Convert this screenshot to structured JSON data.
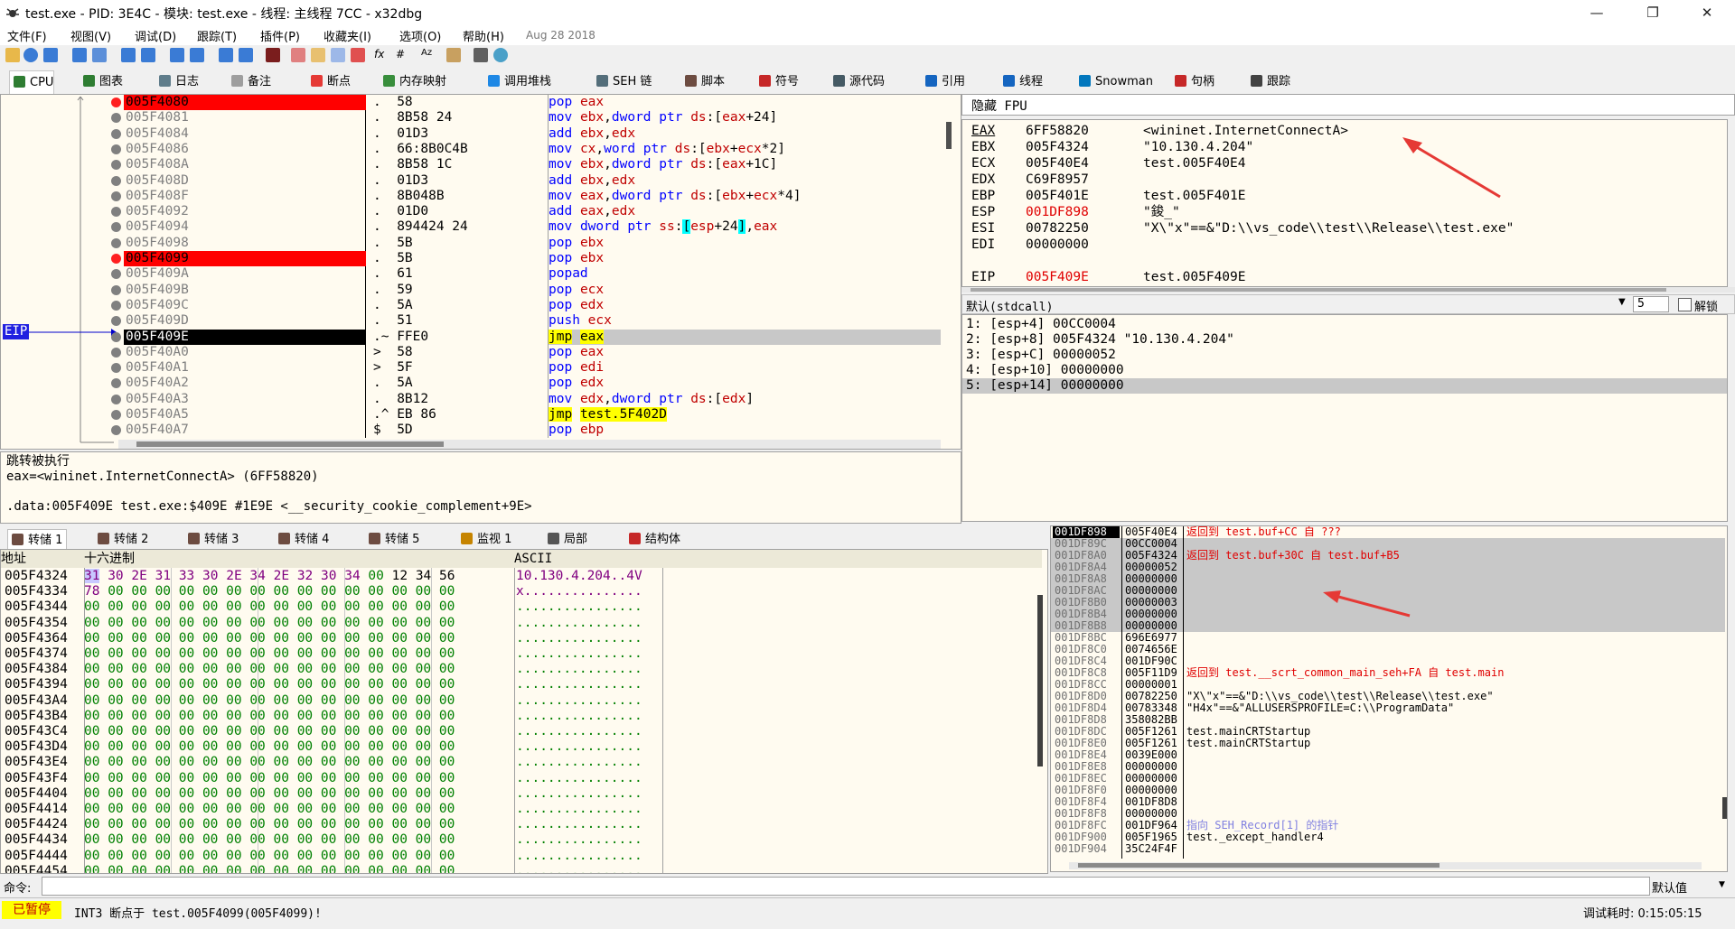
{
  "window": {
    "title": "test.exe - PID: 3E4C - 模块: test.exe - 线程: 主线程 7CC - x32dbg",
    "min_label": "—",
    "max_label": "❐",
    "close_label": "✕"
  },
  "menu": {
    "items": [
      "文件(F)",
      "视图(V)",
      "调试(D)",
      "跟踪(T)",
      "插件(P)",
      "收藏夹(I)",
      "选项(O)",
      "帮助(H)"
    ],
    "date": "Aug 28 2018"
  },
  "toolbar": {
    "fx": "fx",
    "hash": "#",
    "az": "Az"
  },
  "tabs": [
    {
      "label": "CPU",
      "icon": "cpu-icon",
      "color": "#2e7d32"
    },
    {
      "label": "图表",
      "icon": "graph-icon",
      "color": "#2e7d32"
    },
    {
      "label": "日志",
      "icon": "log-icon",
      "color": "#607d8b"
    },
    {
      "label": "备注",
      "icon": "notes-icon",
      "color": "#9e9e9e"
    },
    {
      "label": "断点",
      "icon": "breakpoint-icon",
      "color": "#e53935"
    },
    {
      "label": "内存映射",
      "icon": "memory-map-icon",
      "color": "#388e3c"
    },
    {
      "label": "调用堆栈",
      "icon": "call-stack-icon",
      "color": "#1e88e5"
    },
    {
      "label": "SEH 链",
      "icon": "seh-icon",
      "color": "#546e7a"
    },
    {
      "label": "脚本",
      "icon": "script-icon",
      "color": "#6d4c41"
    },
    {
      "label": "符号",
      "icon": "symbols-icon",
      "color": "#c62828"
    },
    {
      "label": "源代码",
      "icon": "source-icon",
      "color": "#455a64"
    },
    {
      "label": "引用",
      "icon": "references-icon",
      "color": "#1565c0"
    },
    {
      "label": "线程",
      "icon": "threads-icon",
      "color": "#1565c0"
    },
    {
      "label": "Snowman",
      "icon": "snowman-icon",
      "color": "#0277bd"
    },
    {
      "label": "句柄",
      "icon": "handles-icon",
      "color": "#c62828"
    },
    {
      "label": "跟踪",
      "icon": "trace-icon",
      "color": "#424242"
    }
  ],
  "disasm": {
    "eip_label": "EIP",
    "rows": [
      {
        "addr": "005F4080",
        "bp": true,
        "bytes": ".  58",
        "ins": "pop eax"
      },
      {
        "addr": "005F4081",
        "bytes": ".  8B58 24",
        "ins": "mov ebx,dword ptr ds:[eax+24]"
      },
      {
        "addr": "005F4084",
        "bytes": ".  01D3",
        "ins": "add ebx,edx"
      },
      {
        "addr": "005F4086",
        "bytes": ".  66:8B0C4B",
        "ins": "mov cx,word ptr ds:[ebx+ecx*2]"
      },
      {
        "addr": "005F408A",
        "bytes": ".  8B58 1C",
        "ins": "mov ebx,dword ptr ds:[eax+1C]"
      },
      {
        "addr": "005F408D",
        "bytes": ".  01D3",
        "ins": "add ebx,edx"
      },
      {
        "addr": "005F408F",
        "bytes": ".  8B048B",
        "ins": "mov eax,dword ptr ds:[ebx+ecx*4]"
      },
      {
        "addr": "005F4092",
        "bytes": ".  01D0",
        "ins": "add eax,edx"
      },
      {
        "addr": "005F4094",
        "bytes": ".  894424 24",
        "ins": "mov dword ptr ss:[esp+24],eax"
      },
      {
        "addr": "005F4098",
        "bytes": ".  5B",
        "ins": "pop ebx"
      },
      {
        "addr": "005F4099",
        "bp": true,
        "bytes": ".  5B",
        "ins": "pop ebx"
      },
      {
        "addr": "005F409A",
        "bytes": ".  61",
        "ins": "popad"
      },
      {
        "addr": "005F409B",
        "bytes": ".  59",
        "ins": "pop ecx"
      },
      {
        "addr": "005F409C",
        "bytes": ".  5A",
        "ins": "pop edx"
      },
      {
        "addr": "005F409D",
        "bytes": ".  51",
        "ins": "push ecx"
      },
      {
        "addr": "005F409E",
        "eip": true,
        "bytes": ".~ FFE0",
        "ins": "jmp eax"
      },
      {
        "addr": "005F40A0",
        "bytes": ">  58",
        "ins": "pop eax"
      },
      {
        "addr": "005F40A1",
        "bytes": ">  5F",
        "ins": "pop edi"
      },
      {
        "addr": "005F40A2",
        "bytes": ".  5A",
        "ins": "pop edx"
      },
      {
        "addr": "005F40A3",
        "bytes": ".  8B12",
        "ins": "mov edx,dword ptr ds:[edx]"
      },
      {
        "addr": "005F40A5",
        "bytes": ".^ EB 86",
        "ins": "jmp test.5F402D"
      },
      {
        "addr": "005F40A7",
        "bytes": "$  5D",
        "ins": "pop ebp"
      }
    ]
  },
  "info": {
    "line1": "跳转被执行",
    "line2": "eax=<wininet.InternetConnectA> (6FF58820)",
    "line3": ".data:005F409E test.exe:$409E #1E9E <__security_cookie_complement+9E>"
  },
  "regs": {
    "header": "隐藏 FPU",
    "rows": [
      {
        "name": "EAX",
        "value": "6FF58820",
        "comment": "<wininet.InternetConnectA>",
        "red": false,
        "ul": true
      },
      {
        "name": "EBX",
        "value": "005F4324",
        "comment": "\"10.130.4.204\""
      },
      {
        "name": "ECX",
        "value": "005F40E4",
        "comment": "test.005F40E4"
      },
      {
        "name": "EDX",
        "value": "C69F8957",
        "comment": ""
      },
      {
        "name": "EBP",
        "value": "005F401E",
        "comment": "test.005F401E"
      },
      {
        "name": "ESP",
        "value": "001DF898",
        "comment": "\"鋑_\"",
        "red": true
      },
      {
        "name": "ESI",
        "value": "00782250",
        "comment": "\"X\\\"x\"==&\"D:\\\\vs_code\\\\test\\\\Release\\\\test.exe\""
      },
      {
        "name": "EDI",
        "value": "00000000",
        "comment": ""
      },
      {
        "name": "EIP",
        "value": "005F409E",
        "comment": "test.005F409E",
        "red": true
      }
    ]
  },
  "callconv": {
    "label": "默认(stdcall)",
    "count": "5",
    "unlock": "解锁"
  },
  "args": [
    "1: [esp+4] 00CC0004",
    "2: [esp+8] 005F4324 \"10.130.4.204\"",
    "3: [esp+C] 00000052",
    "4: [esp+10] 00000000",
    "5: [esp+14] 00000000"
  ],
  "dump_tabs": [
    {
      "label": "转储 1",
      "icon": "dump-icon"
    },
    {
      "label": "转储 2",
      "icon": "dump-icon"
    },
    {
      "label": "转储 3",
      "icon": "dump-icon"
    },
    {
      "label": "转储 4",
      "icon": "dump-icon"
    },
    {
      "label": "转储 5",
      "icon": "dump-icon"
    },
    {
      "label": "监视 1",
      "icon": "watch-icon"
    },
    {
      "label": "局部",
      "icon": "locals-icon"
    },
    {
      "label": "结构体",
      "icon": "struct-icon"
    }
  ],
  "dump": {
    "col_addr": "地址",
    "col_hex": "十六进制",
    "col_ascii": "ASCII",
    "rows": [
      {
        "addr": "005F4324",
        "hex": "31 30 2E 31 33 30 2E 34 2E 32 30 34 00 12 34 56",
        "ascii": "10.130.4.204..4V"
      },
      {
        "addr": "005F4334",
        "hex": "78 00 00 00 00 00 00 00 00 00 00 00 00 00 00 00",
        "ascii": "x..............."
      },
      {
        "addr": "005F4344",
        "hex": "00 00 00 00 00 00 00 00 00 00 00 00 00 00 00 00",
        "ascii": "................"
      },
      {
        "addr": "005F4354",
        "hex": "00 00 00 00 00 00 00 00 00 00 00 00 00 00 00 00",
        "ascii": "................"
      },
      {
        "addr": "005F4364",
        "hex": "00 00 00 00 00 00 00 00 00 00 00 00 00 00 00 00",
        "ascii": "................"
      },
      {
        "addr": "005F4374",
        "hex": "00 00 00 00 00 00 00 00 00 00 00 00 00 00 00 00",
        "ascii": "................"
      },
      {
        "addr": "005F4384",
        "hex": "00 00 00 00 00 00 00 00 00 00 00 00 00 00 00 00",
        "ascii": "................"
      },
      {
        "addr": "005F4394",
        "hex": "00 00 00 00 00 00 00 00 00 00 00 00 00 00 00 00",
        "ascii": "................"
      },
      {
        "addr": "005F43A4",
        "hex": "00 00 00 00 00 00 00 00 00 00 00 00 00 00 00 00",
        "ascii": "................"
      },
      {
        "addr": "005F43B4",
        "hex": "00 00 00 00 00 00 00 00 00 00 00 00 00 00 00 00",
        "ascii": "................"
      },
      {
        "addr": "005F43C4",
        "hex": "00 00 00 00 00 00 00 00 00 00 00 00 00 00 00 00",
        "ascii": "................"
      },
      {
        "addr": "005F43D4",
        "hex": "00 00 00 00 00 00 00 00 00 00 00 00 00 00 00 00",
        "ascii": "................"
      },
      {
        "addr": "005F43E4",
        "hex": "00 00 00 00 00 00 00 00 00 00 00 00 00 00 00 00",
        "ascii": "................"
      },
      {
        "addr": "005F43F4",
        "hex": "00 00 00 00 00 00 00 00 00 00 00 00 00 00 00 00",
        "ascii": "................"
      },
      {
        "addr": "005F4404",
        "hex": "00 00 00 00 00 00 00 00 00 00 00 00 00 00 00 00",
        "ascii": "................"
      },
      {
        "addr": "005F4414",
        "hex": "00 00 00 00 00 00 00 00 00 00 00 00 00 00 00 00",
        "ascii": "................"
      },
      {
        "addr": "005F4424",
        "hex": "00 00 00 00 00 00 00 00 00 00 00 00 00 00 00 00",
        "ascii": "................"
      },
      {
        "addr": "005F4434",
        "hex": "00 00 00 00 00 00 00 00 00 00 00 00 00 00 00 00",
        "ascii": "................"
      },
      {
        "addr": "005F4444",
        "hex": "00 00 00 00 00 00 00 00 00 00 00 00 00 00 00 00",
        "ascii": "................"
      },
      {
        "addr": "005F4454",
        "hex": "00 00 00 00 00 00 00 00 00 00 00 00 00 00 00 00",
        "ascii": "................"
      }
    ]
  },
  "stack": {
    "rows": [
      {
        "addr": "001DF898",
        "val": "005F40E4",
        "comment": "返回到 test.buf+CC 自 ???",
        "top": true,
        "red": true
      },
      {
        "addr": "001DF89C",
        "val": "00CC0004",
        "comment": "",
        "sel": true
      },
      {
        "addr": "001DF8A0",
        "val": "005F4324",
        "comment": "返回到 test.buf+30C 自 test.buf+B5",
        "sel": true,
        "red": true
      },
      {
        "addr": "001DF8A4",
        "val": "00000052",
        "comment": "",
        "sel": true
      },
      {
        "addr": "001DF8A8",
        "val": "00000000",
        "comment": "",
        "sel": true
      },
      {
        "addr": "001DF8AC",
        "val": "00000000",
        "comment": "",
        "sel": true
      },
      {
        "addr": "001DF8B0",
        "val": "00000003",
        "comment": "",
        "sel": true
      },
      {
        "addr": "001DF8B4",
        "val": "00000000",
        "comment": "",
        "sel": true
      },
      {
        "addr": "001DF8B8",
        "val": "00000000",
        "comment": "",
        "sel": true
      },
      {
        "addr": "001DF8BC",
        "val": "696E6977",
        "comment": ""
      },
      {
        "addr": "001DF8C0",
        "val": "0074656E",
        "comment": ""
      },
      {
        "addr": "001DF8C4",
        "val": "001DF90C",
        "comment": ""
      },
      {
        "addr": "001DF8C8",
        "val": "005F11D9",
        "comment": "返回到 test.__scrt_common_main_seh+FA 自 test.main",
        "red": true
      },
      {
        "addr": "001DF8CC",
        "val": "00000001",
        "comment": ""
      },
      {
        "addr": "001DF8D0",
        "val": "00782250",
        "comment": "\"X\\\"x\"==&\"D:\\\\vs_code\\\\test\\\\Release\\\\test.exe\""
      },
      {
        "addr": "001DF8D4",
        "val": "00783348",
        "comment": "\"H4x\"==&\"ALLUSERSPROFILE=C:\\\\ProgramData\""
      },
      {
        "addr": "001DF8D8",
        "val": "358082BB",
        "comment": ""
      },
      {
        "addr": "001DF8DC",
        "val": "005F1261",
        "comment": "test.mainCRTStartup"
      },
      {
        "addr": "001DF8E0",
        "val": "005F1261",
        "comment": "test.mainCRTStartup"
      },
      {
        "addr": "001DF8E4",
        "val": "0039E000",
        "comment": ""
      },
      {
        "addr": "001DF8E8",
        "val": "00000000",
        "comment": ""
      },
      {
        "addr": "001DF8EC",
        "val": "00000000",
        "comment": ""
      },
      {
        "addr": "001DF8F0",
        "val": "00000000",
        "comment": ""
      },
      {
        "addr": "001DF8F4",
        "val": "001DF8D8",
        "comment": ""
      },
      {
        "addr": "001DF8F8",
        "val": "00000000",
        "comment": ""
      },
      {
        "addr": "001DF8FC",
        "val": "001DF964",
        "comment": "指向 SEH_Record[1] 的指针",
        "seh": true
      },
      {
        "addr": "001DF900",
        "val": "005F1965",
        "comment": "test._except_handler4"
      },
      {
        "addr": "001DF904",
        "val": "35C24F4F",
        "comment": ""
      }
    ]
  },
  "command": {
    "label": "命令:",
    "mode": "默认值"
  },
  "status": {
    "state": "已暂停",
    "message": "INT3 断点于 test.005F4099(005F4099)!",
    "elapsed": "调试耗时: 0:15:05:15"
  },
  "colors": {
    "breakpoint": "#ff0000",
    "eip_row": "#000000",
    "pane_bg": "#fffbf0",
    "annotation": "#e53935"
  }
}
